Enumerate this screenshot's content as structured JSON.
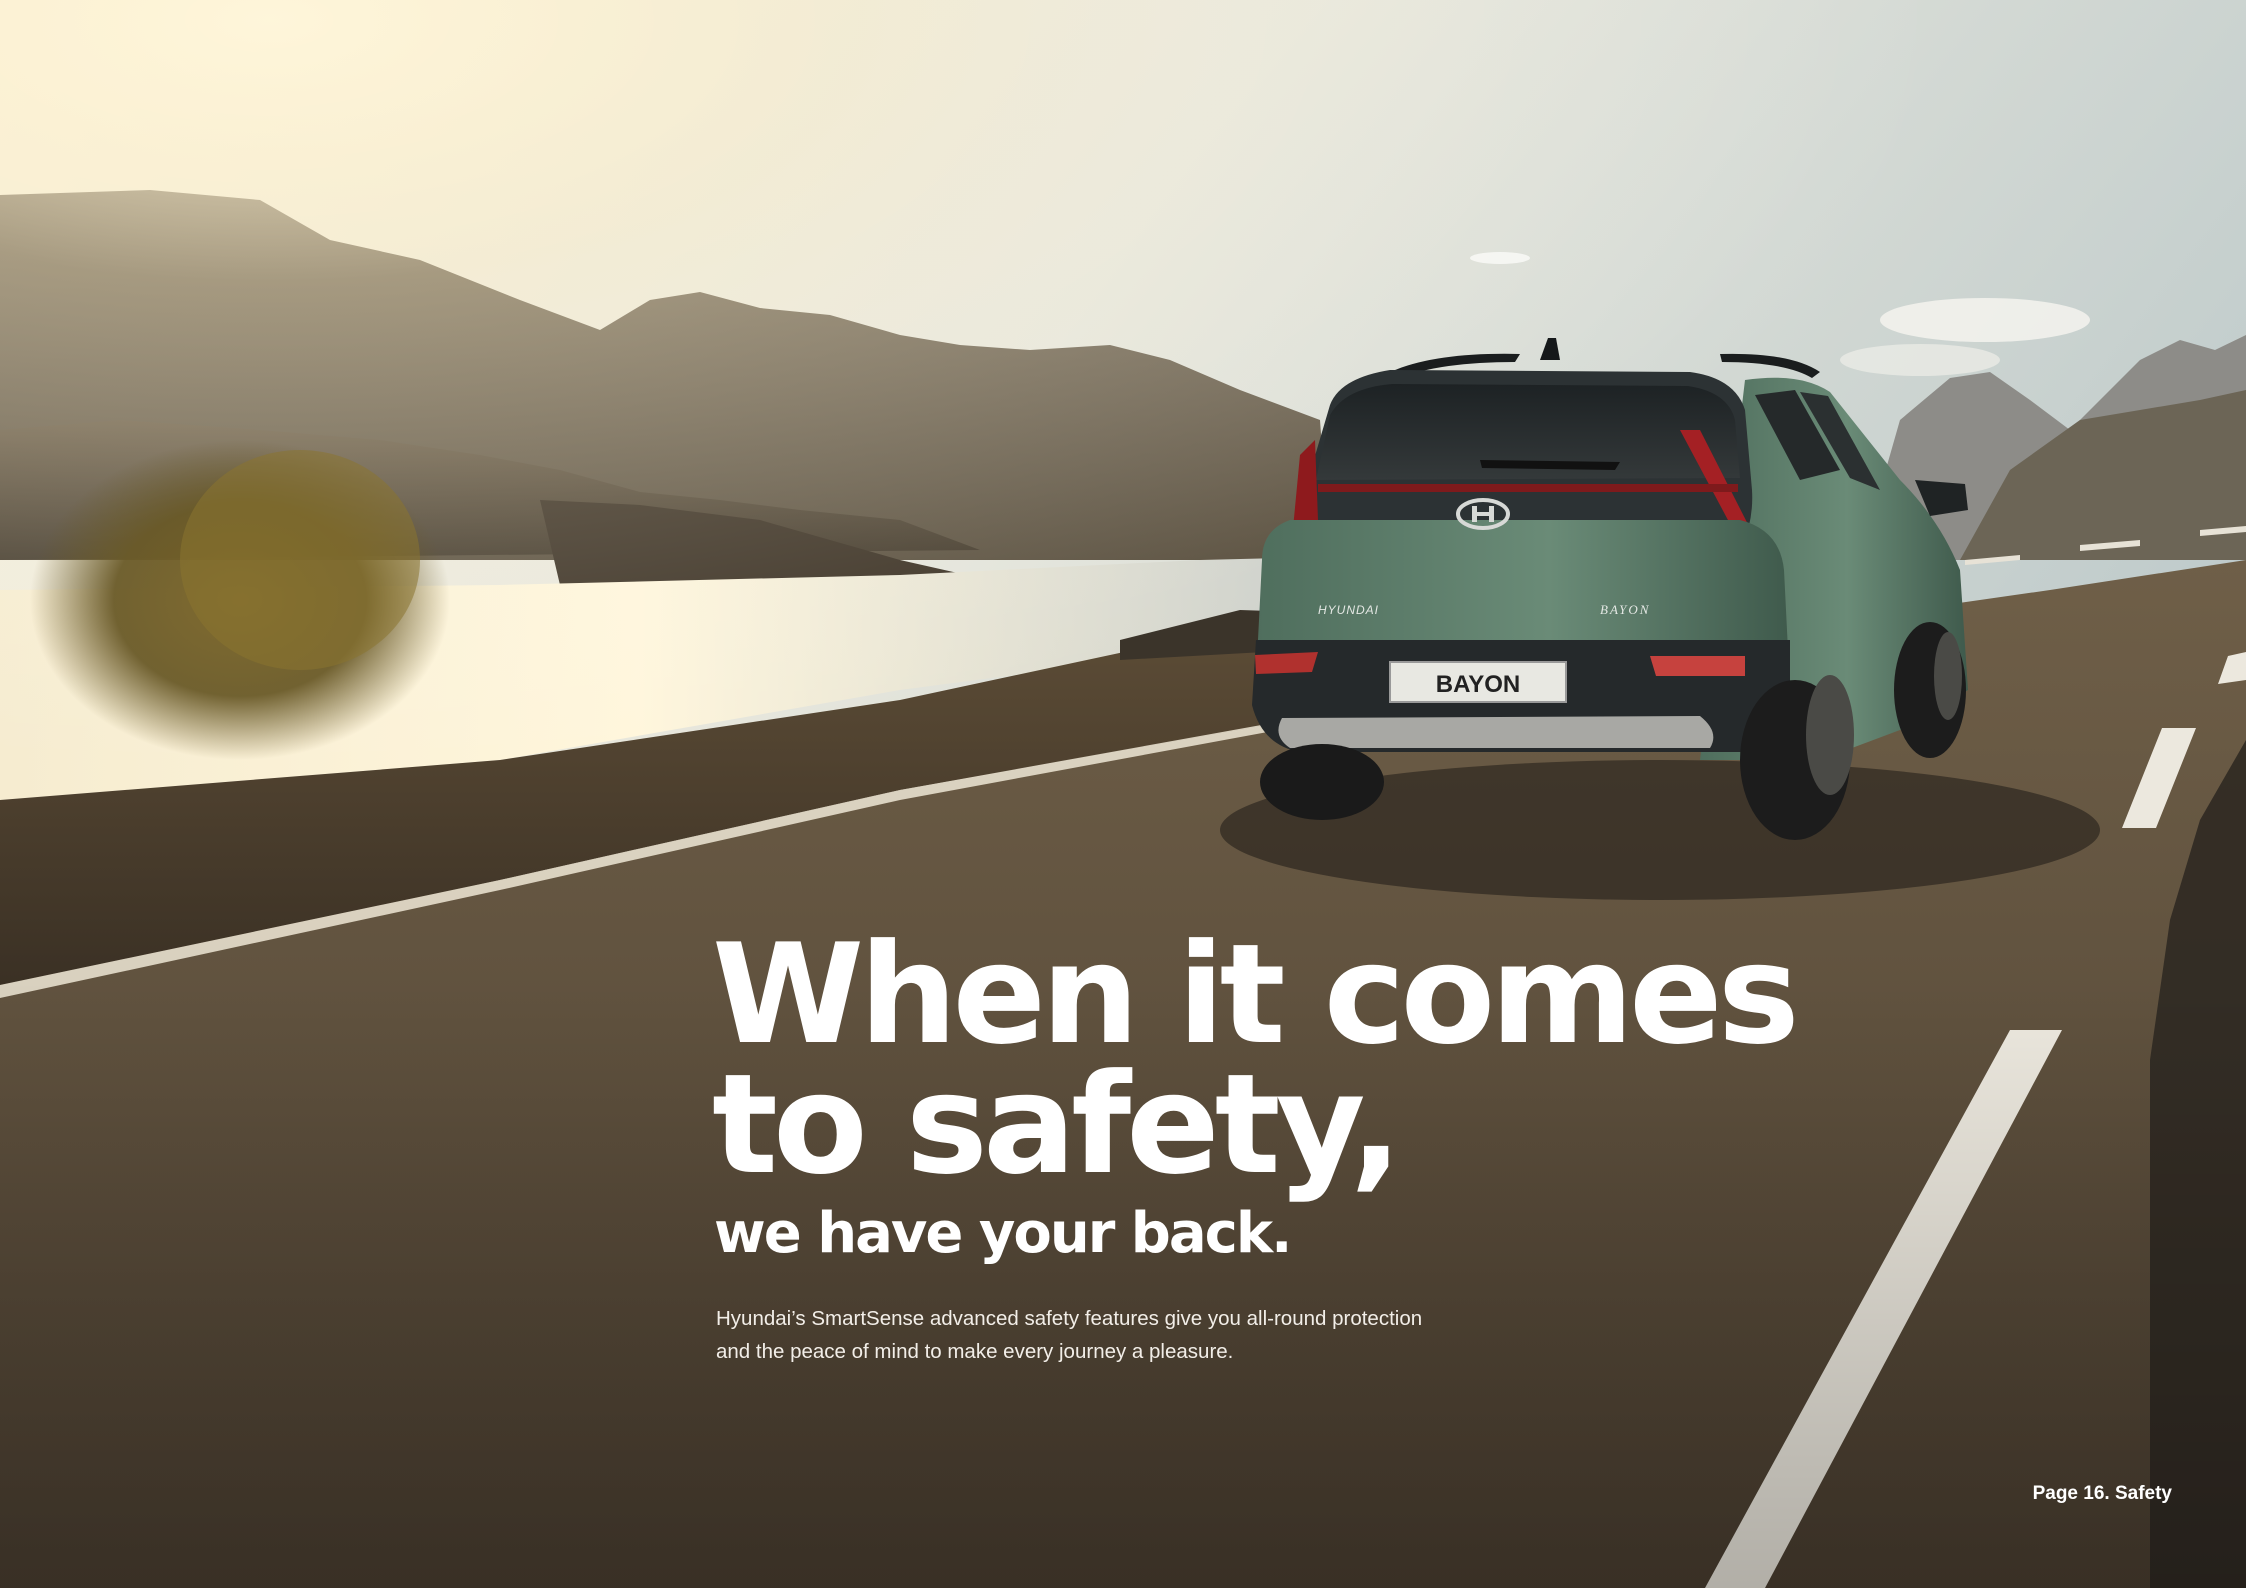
{
  "car": {
    "badge": "BAYON",
    "plate": "BAYON",
    "brand_script": "HYUNDAI"
  },
  "headline": {
    "line1": "When it comes",
    "line2": "to safety,",
    "subline": "we have your back."
  },
  "body": {
    "line1": "Hyundai’s SmartSense advanced safety features give you all-round protection",
    "line2": "and the peace of mind to make every journey a pleasure."
  },
  "footer": {
    "page_label": "Page 16. Safety"
  },
  "colors": {
    "text": "#ffffff",
    "car_body": "#5d7f6c",
    "road": "#5b4d3c"
  },
  "icons": {
    "brand_logo": "hyundai-logo-icon"
  }
}
